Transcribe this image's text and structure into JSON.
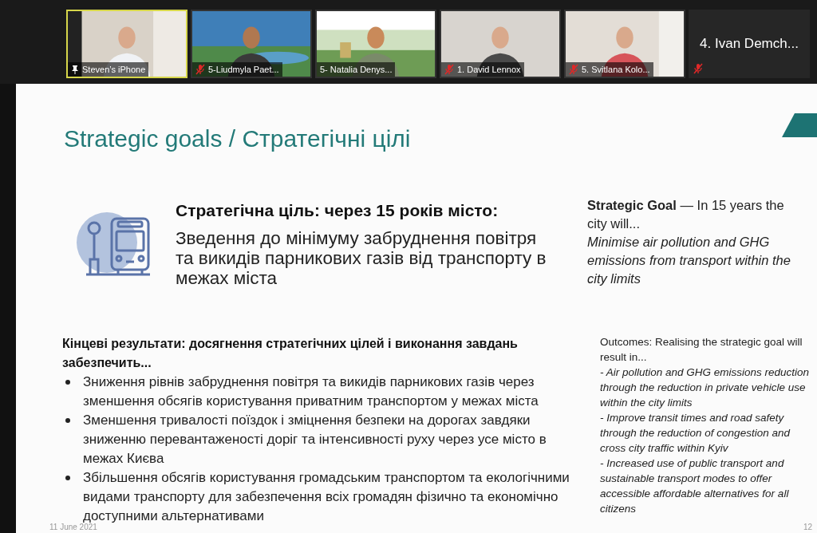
{
  "participants": [
    {
      "name": "Steven’s iPhone",
      "muted": false,
      "pinned": true,
      "speaking": true,
      "video": true
    },
    {
      "name": "5-Liudmyla Paet...",
      "muted": true,
      "pinned": false,
      "speaking": false,
      "video": true
    },
    {
      "name": "5- Natalia Denys...",
      "muted": false,
      "pinned": false,
      "speaking": false,
      "video": true
    },
    {
      "name": "1. David Lennox",
      "muted": true,
      "pinned": false,
      "speaking": false,
      "video": true
    },
    {
      "name": "5. Svitlana Kolo...",
      "muted": true,
      "pinned": false,
      "speaking": false,
      "video": true
    },
    {
      "name": "4. Ivan Demch...",
      "muted": true,
      "pinned": false,
      "speaking": false,
      "video": false
    }
  ],
  "slide": {
    "title": "Strategic goals / Стратегічні цілі",
    "goal_heading": "Стратегічна ціль: через 15 років місто:",
    "goal_text": "Зведення до мінімуму забруднення повітря та викидів парникових газів від транспорту в межах міста",
    "outcomes_heading": "Кінцеві результати: досягнення стратегічних цілей і виконання завдань забезпечить...",
    "outcomes": [
      "Зниження рівнів забруднення повітря та викидів парникових газів через зменшення обсягів користування приватним транспортом у межах міста",
      "Зменшення тривалості поїздок і зміцнення безпеки на дорогах завдяки зниженню перевантаженості доріг та інтенсивності руху через усе місто в межах Києва",
      "Збільшення обсягів користування громадським транспортом та екологічними видами транспорту для забезпечення всіх громадян фізично та економічно доступними альтернативами"
    ],
    "en_goal_intro": "**Strategic Goal** — In 15 years the city will...",
    "en_goal_text": "Minimise air pollution and GHG emissions from transport within the city limits",
    "en_outcomes_intro": "Outcomes: Realising the strategic goal will result in...",
    "en_outcomes": [
      "- Air pollution and GHG emissions reduction through the reduction in private vehicle use within the city limits",
      "- Improve transit times and road safety through the reduction of congestion and cross city traffic within Kyiv",
      "- Increased use of public transport and sustainable transport modes to offer accessible affordable alternatives for all citizens"
    ],
    "date": "11 June 2021",
    "page": "12"
  }
}
